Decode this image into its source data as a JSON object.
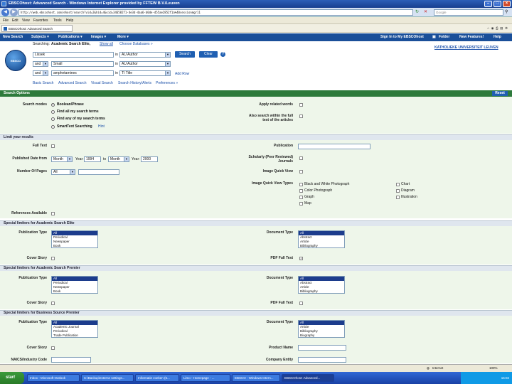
{
  "window": {
    "title": "EBSCOhost: Advanced Search - Windows Internet Explorer provided by FFTEW B.V./Leuven",
    "min_icon": "minimize-icon",
    "max_icon": "maximize-icon",
    "close_icon": "close-icon"
  },
  "address": {
    "url": "http://web.ebscohost.com/ehost/search?vid=2&hid=4&sid=34658271-4e3d-4aa6-b0de-d55ae2852f1a%40sessionmgr11",
    "search_placeholder": "Google"
  },
  "menu": [
    "File",
    "Edit",
    "View",
    "Favorites",
    "Tools",
    "Help"
  ],
  "tab": {
    "title": "EBSCOhost: Advanced Search"
  },
  "toolbar": {
    "left": [
      "New Search",
      "Subjects ▾",
      "Publications ▾",
      "Images ▾",
      "More ▾"
    ],
    "right": [
      "Sign In to My EBSCOhost",
      "Folder",
      "New Features!",
      "Help"
    ]
  },
  "search": {
    "searching_label": "Searching:",
    "database": "Academic Search Elite,",
    "show_all": "Show all",
    "choose_db": "Choose Databases »",
    "institution": "KATHOLIEKE UNIVERSITEIT LEUVEN",
    "rows": [
      {
        "bool": "",
        "term": "Lissek",
        "in_label": "in",
        "field": "AU Author"
      },
      {
        "bool": "and",
        "term": "Small",
        "in_label": "in",
        "field": "AU Author"
      },
      {
        "bool": "and",
        "term": "amphetamines",
        "in_label": "in",
        "field": "TI Title"
      }
    ],
    "search_btn": "Search",
    "clear_btn": "Clear",
    "add_row": "Add Row",
    "tabs": [
      "Basic Search",
      "Advanced Search",
      "Visual Search",
      "Search History/Alerts",
      "Preferences »"
    ]
  },
  "options": {
    "title": "Search Options",
    "reset": "Reset",
    "search_modes_label": "Search modes",
    "modes": [
      "Boolean/Phrase",
      "Find all my search terms",
      "Find any of my search terms",
      "SmartText Searching"
    ],
    "hint": "Hint",
    "apply_related": "Apply related words",
    "also_search": "Also search within the full text of the articles"
  },
  "limit": {
    "title": "Limit your results",
    "full_text": "Full Text",
    "publication": "Publication",
    "pub_date_from": "Published Date from",
    "month1": "Month",
    "year_label": "Year:",
    "year1": "1994",
    "to_label": "to",
    "month2": "Month",
    "year2": "2000",
    "scholarly": "Scholarly (Peer Reviewed) Journals",
    "num_pages": "Number Of Pages",
    "pages_sel": "All",
    "image_quick_view": "Image Quick View",
    "image_types_label": "Image Quick View Types",
    "image_types": [
      "Black and White Photograph",
      "Chart",
      "Color Photograph",
      "Diagram",
      "Graph",
      "Illustration",
      "Map"
    ],
    "references": "References Available"
  },
  "special1": {
    "title": "Special limiters for Academic Search Elite",
    "pubtype_label": "Publication Type",
    "pubtypes": [
      "All",
      "Periodical",
      "Newspaper",
      "Book"
    ],
    "doctype_label": "Document Type",
    "doctypes": [
      "All",
      "Abstract",
      "Article",
      "Bibliography"
    ],
    "cover_story": "Cover Story",
    "pdf_full_text": "PDF Full Text"
  },
  "special2": {
    "title": "Special limiters for Academic Search Premier",
    "pubtype_label": "Publication Type",
    "pubtypes": [
      "All",
      "Periodical",
      "Newspaper",
      "Book"
    ],
    "doctype_label": "Document Type",
    "doctypes": [
      "All",
      "Abstract",
      "Article",
      "Bibliography"
    ],
    "cover_story": "Cover Story",
    "pdf_full_text": "PDF Full Text"
  },
  "special3": {
    "title": "Special limiters for Business Source Premier",
    "pubtype_label": "Publication Type",
    "pubtypes": [
      "All",
      "Academic Journal",
      "Periodical",
      "Trade Publication"
    ],
    "doctype_label": "Document Type",
    "doctypes": [
      "All",
      "Article",
      "Bibliography",
      "Biography"
    ],
    "cover_story": "Cover Story",
    "product_name": "Product Name",
    "naics": "NAICS/Industry Code",
    "company_entity": "Company Entity"
  },
  "status": {
    "text": "Internet",
    "zoom": "100%"
  },
  "taskbar": {
    "start": "start",
    "items": [
      "Inbox - Microsoft Outlook",
      "C:\\Backup\\externe settings...",
      "Informatie zoeken (6...",
      "Limo - Homepage - ...",
      "EBSCO - Windows Intern...",
      "EBSCOhost: Advanced..."
    ],
    "clock": "15:02"
  }
}
